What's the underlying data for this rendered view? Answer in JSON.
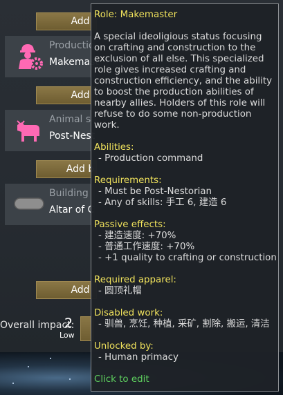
{
  "list": {
    "add_buttons": [
      "Add",
      "Add",
      "Add b",
      "Add"
    ],
    "roles": [
      {
        "category": "Productio",
        "name": "Makemast",
        "icon": "worker-gear-icon"
      },
      {
        "category": "Animal sa",
        "name": "Post-Nest",
        "icon": "cow-icon"
      },
      {
        "category": "Building",
        "name": "Altar of C",
        "icon": "altar-icon"
      }
    ],
    "overall_impact": {
      "label": "Overall impact:",
      "value": "2",
      "level": "Low"
    }
  },
  "tooltip": {
    "title": "Role: Makemaster",
    "description": "A special ideoligious status focusing on crafting and construction to the exclusion of all else. This specialized role gives increased crafting and construction efficiency, and the ability to boost the production abilities of nearby allies. Holders of this role will refuse to do some non-production work.",
    "sections": [
      {
        "heading": "Abilities:",
        "items": [
          "- Production command"
        ]
      },
      {
        "heading": "Requirements:",
        "items": [
          "- Must be Post-Nestorian",
          "- Any of skills: 手工 6, 建造 6"
        ]
      },
      {
        "heading": "Passive effects:",
        "items": [
          "- 建造速度: +70%",
          "- 普通工作速度: +70%",
          "- +1 quality to crafting or construction"
        ]
      },
      {
        "heading": "Required apparel:",
        "items": [
          "- 圆顶礼帽"
        ]
      },
      {
        "heading": "Disabled work:",
        "items": [
          "- 驯兽, 烹饪, 种植, 采矿, 割除, 搬运, 清洁"
        ]
      },
      {
        "heading": "Unlocked by:",
        "items": [
          "- Human primacy"
        ]
      }
    ],
    "click_hint": "Click to edit"
  },
  "colors": {
    "heading": "#f0e25c",
    "click_hint": "#5ed05e",
    "role_icon": "#ff69b4",
    "button": "#7c6a3c"
  }
}
